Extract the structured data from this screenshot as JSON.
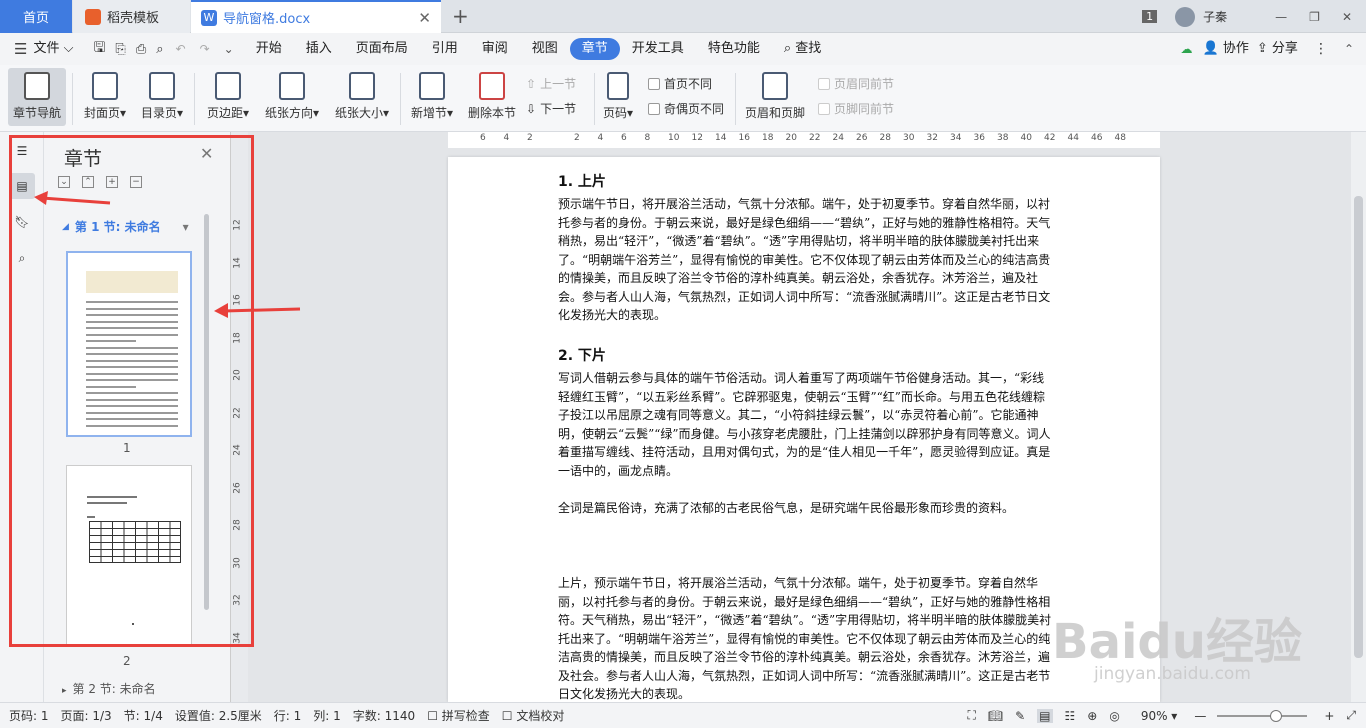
{
  "tabs": {
    "home": "首页",
    "template": "稻壳模板",
    "doc": "导航窗格.docx"
  },
  "titlebar": {
    "badge": "1",
    "user": "子秦"
  },
  "menubar": {
    "file": "文件",
    "items": [
      "开始",
      "插入",
      "页面布局",
      "引用",
      "审阅",
      "视图",
      "章节",
      "开发工具",
      "特色功能"
    ],
    "active": "章节",
    "search": "查找",
    "collab": "协作",
    "share": "分享"
  },
  "ribbon": {
    "nav": "章节导航",
    "cover": "封面页",
    "toc": "目录页",
    "margin": "页边距",
    "orientation": "纸张方向",
    "size": "纸张大小",
    "newsec": "新增节",
    "delsec": "删除本节",
    "prev": "上一节",
    "next": "下一节",
    "pagenum": "页码",
    "firstdiff": "首页不同",
    "oddeven": "奇偶页不同",
    "headerfooter": "页眉和页脚",
    "sameheader": "页眉同前节",
    "samefooter": "页脚同前节"
  },
  "navpanel": {
    "title": "章节",
    "section1": "第 1 节: 未命名",
    "page1": "1",
    "page2": "2",
    "section2": "第 2 节: 未命名"
  },
  "document": {
    "h1": "1. 上片",
    "p1": "预示端午节日，将开展浴兰活动，气氛十分浓郁。端午，处于初夏季节。穿着自然华丽，以衬托参与者的身份。于朝云来说，最好是绿色细绢——“碧纨”，正好与她的雅静性格相符。天气稍热，易出“轻汗”，“微透”着“碧纨”。“透”字用得贴切，将半明半暗的肤体朦胧美衬托出来了。“明朝端午浴芳兰”，显得有愉悦的审美性。它不仅体现了朝云由芳体而及兰心的纯洁高贵的情操美，而且反映了浴兰令节俗的淳朴纯真美。朝云浴处，余香犹存。沐芳浴兰，遍及社会。参与者人山人海，气氛热烈，正如词人词中所写：“流香涨腻满晴川”。这正是古老节日文化发扬光大的表现。",
    "h2": "2. 下片",
    "p2": "写词人借朝云参与具体的端午节俗活动。词人着重写了两项端午节俗健身活动。其一，“彩线轻缠红玉臂”，“以五彩丝系臂”。它辟邪驱鬼，使朝云“玉臂”“红”而长命。与用五色花线缠粽子投江以吊屈原之魂有同等意义。其二，“小符斜挂绿云鬟”，以“赤灵符着心前”。它能通神明，使朝云“云鬓”“绿”而身健。与小孩穿老虎腰肚，门上挂蒲剑以辟邪护身有同等意义。词人着重描写缠线、挂符活动，且用对偶句式，为的是“佳人相见一千年”，愿灵验得到应证。真是一语中的，画龙点睛。",
    "p3": "全词是篇民俗诗，充满了浓郁的古老民俗气息，是研究端午民俗最形象而珍贵的资料。",
    "p4": "上片，预示端午节日，将开展浴兰活动，气氛十分浓郁。端午，处于初夏季节。穿着自然华丽，以衬托参与者的身份。于朝云来说，最好是绿色细绢——“碧纨”，正好与她的雅静性格相符。天气稍热，易出“轻汗”，“微透”着“碧纨”。“透”字用得贴切，将半明半暗的肤体朦胧美衬托出来了。“明朝端午浴芳兰”，显得有愉悦的审美性。它不仅体现了朝云由芳体而及兰心的纯洁高贵的情操美，而且反映了浴兰令节俗的淳朴纯真美。朝云浴处，余香犹存。沐芳浴兰，遍及社会。参与者人山人海，气氛热烈，正如词人词中所写：“流香涨腻满晴川”。这正是古老节日文化发扬光大的表现。"
  },
  "ruler_h": [
    "6",
    "4",
    "2",
    "",
    "2",
    "4",
    "6",
    "8",
    "10",
    "12",
    "14",
    "16",
    "18",
    "20",
    "22",
    "24",
    "26",
    "28",
    "30",
    "32",
    "34",
    "36",
    "38",
    "40",
    "42",
    "44",
    "46",
    "48"
  ],
  "ruler_v": [
    "12",
    "14",
    "16",
    "18",
    "20",
    "22",
    "24",
    "26",
    "28",
    "30",
    "32",
    "34"
  ],
  "statusbar": {
    "page": "页码: 1",
    "pages": "页面: 1/3",
    "section": "节: 1/4",
    "setting": "设置值: 2.5厘米",
    "row": "行: 1",
    "col": "列: 1",
    "words": "字数: 1140",
    "spell": "拼写检查",
    "proof": "文档校对",
    "zoom": "90%"
  },
  "watermark": {
    "brand": "Baidu经验",
    "url": "jingyan.baidu.com"
  },
  "colors": {
    "accent": "#3f7be0",
    "annotation": "#e8403b"
  }
}
